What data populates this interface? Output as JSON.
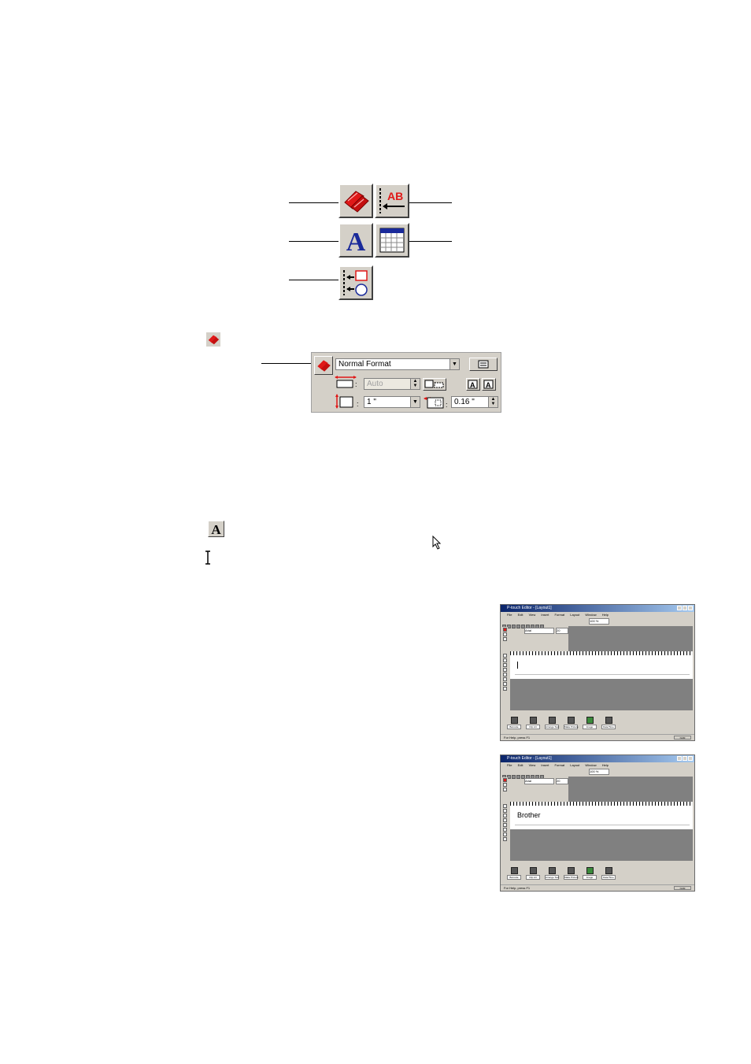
{
  "properties_panel": {
    "format_value": "Normal Format",
    "length_value": "Auto",
    "tape_width_value": "1 \"",
    "margin_value": "0.16 \""
  },
  "screenshot1": {
    "title": "P-touch Editor - [Layout1]",
    "menus": [
      "File",
      "Edit",
      "View",
      "Insert",
      "Format",
      "Layout",
      "Window",
      "Help"
    ],
    "font_value": "Arial",
    "size_value": "20",
    "zoom_value": "100 %",
    "bottom_buttons": [
      "Barcode",
      "Clip Art",
      "Arrange Text",
      "Make Picture",
      "Image",
      "Date/Time"
    ],
    "status_text": "For Help, press F1",
    "num_label": "NUM",
    "typed_text": ""
  },
  "screenshot2": {
    "title": "P-touch Editor - [Layout1]",
    "menus": [
      "File",
      "Edit",
      "View",
      "Insert",
      "Format",
      "Layout",
      "Window",
      "Help"
    ],
    "font_value": "Arial",
    "size_value": "20",
    "zoom_value": "100 %",
    "bottom_buttons": [
      "Barcode",
      "Clip Art",
      "Arrange Text",
      "Make Picture",
      "Image",
      "Date/Time"
    ],
    "status_text": "For Help, press F1",
    "num_label": "NUM",
    "typed_text": "Brother"
  },
  "icons": {
    "palette": [
      "tape-property-icon",
      "text-property-icon",
      "layout-property-icon",
      "arrange-icon",
      "table-property-icon"
    ],
    "accent_red": "#e01818",
    "accent_blue": "#1a2a9a"
  }
}
